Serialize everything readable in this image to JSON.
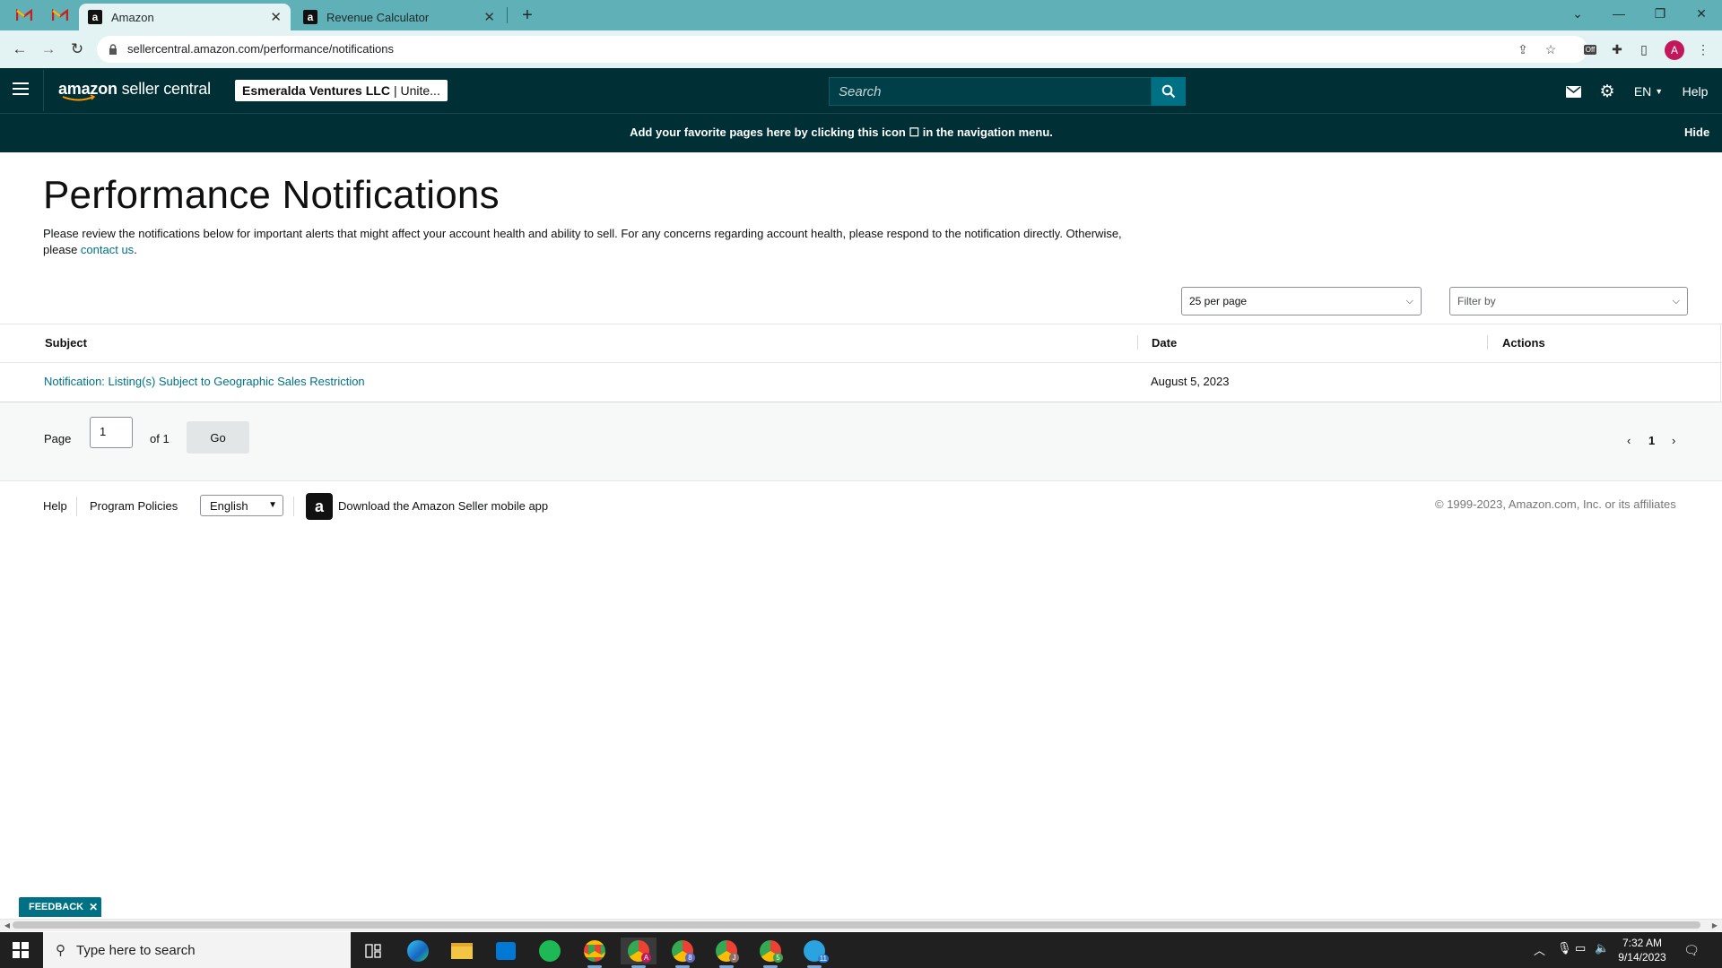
{
  "browser": {
    "tabs": [
      {
        "label": "Amazon",
        "active": true
      },
      {
        "label": "Revenue Calculator",
        "active": false
      }
    ],
    "url": "sellercentral.amazon.com/performance/notifications",
    "profile_initial": "A",
    "extension_badge": "Off"
  },
  "header": {
    "logo_bold": "amazon",
    "logo_rest": " seller central",
    "account_name": "Esmeralda Ventures LLC",
    "account_region": "| Unite...",
    "search_placeholder": "Search",
    "language": "EN",
    "help": "Help"
  },
  "banner": {
    "text": "Add your favorite pages here by clicking this icon ☐ in the navigation menu.",
    "hide": "Hide"
  },
  "page": {
    "title": "Performance Notifications",
    "description": "Please review the notifications below for important alerts that might affect your account health and ability to sell. For any concerns regarding account health, please respond to the notification directly. Otherwise, please ",
    "contact_link": "contact us",
    "description_end": "."
  },
  "controls": {
    "per_page": "25 per page",
    "filter": "Filter by"
  },
  "table": {
    "columns": [
      "Subject",
      "Date",
      "Actions"
    ],
    "rows": [
      {
        "subject": "Notification: Listing(s) Subject to Geographic Sales Restriction",
        "date": "August 5, 2023"
      }
    ]
  },
  "pager": {
    "page_label": "Page",
    "page_value": "1",
    "of_label": "of 1",
    "go": "Go",
    "current": "1"
  },
  "footer": {
    "help": "Help",
    "policies": "Program Policies",
    "language": "English",
    "app_text": "Download the Amazon Seller mobile app",
    "copyright": "© 1999-2023, Amazon.com, Inc. or its affiliates"
  },
  "feedback": "FEEDBACK",
  "taskbar": {
    "search_placeholder": "Type here to search",
    "time": "7:32 AM",
    "date": "9/14/2023",
    "badges": [
      "A",
      "8",
      "J",
      "5",
      "11"
    ]
  },
  "colors": {
    "header_bg": "#002f36",
    "link": "#007185",
    "tabstrip": "#5fb0b7"
  }
}
